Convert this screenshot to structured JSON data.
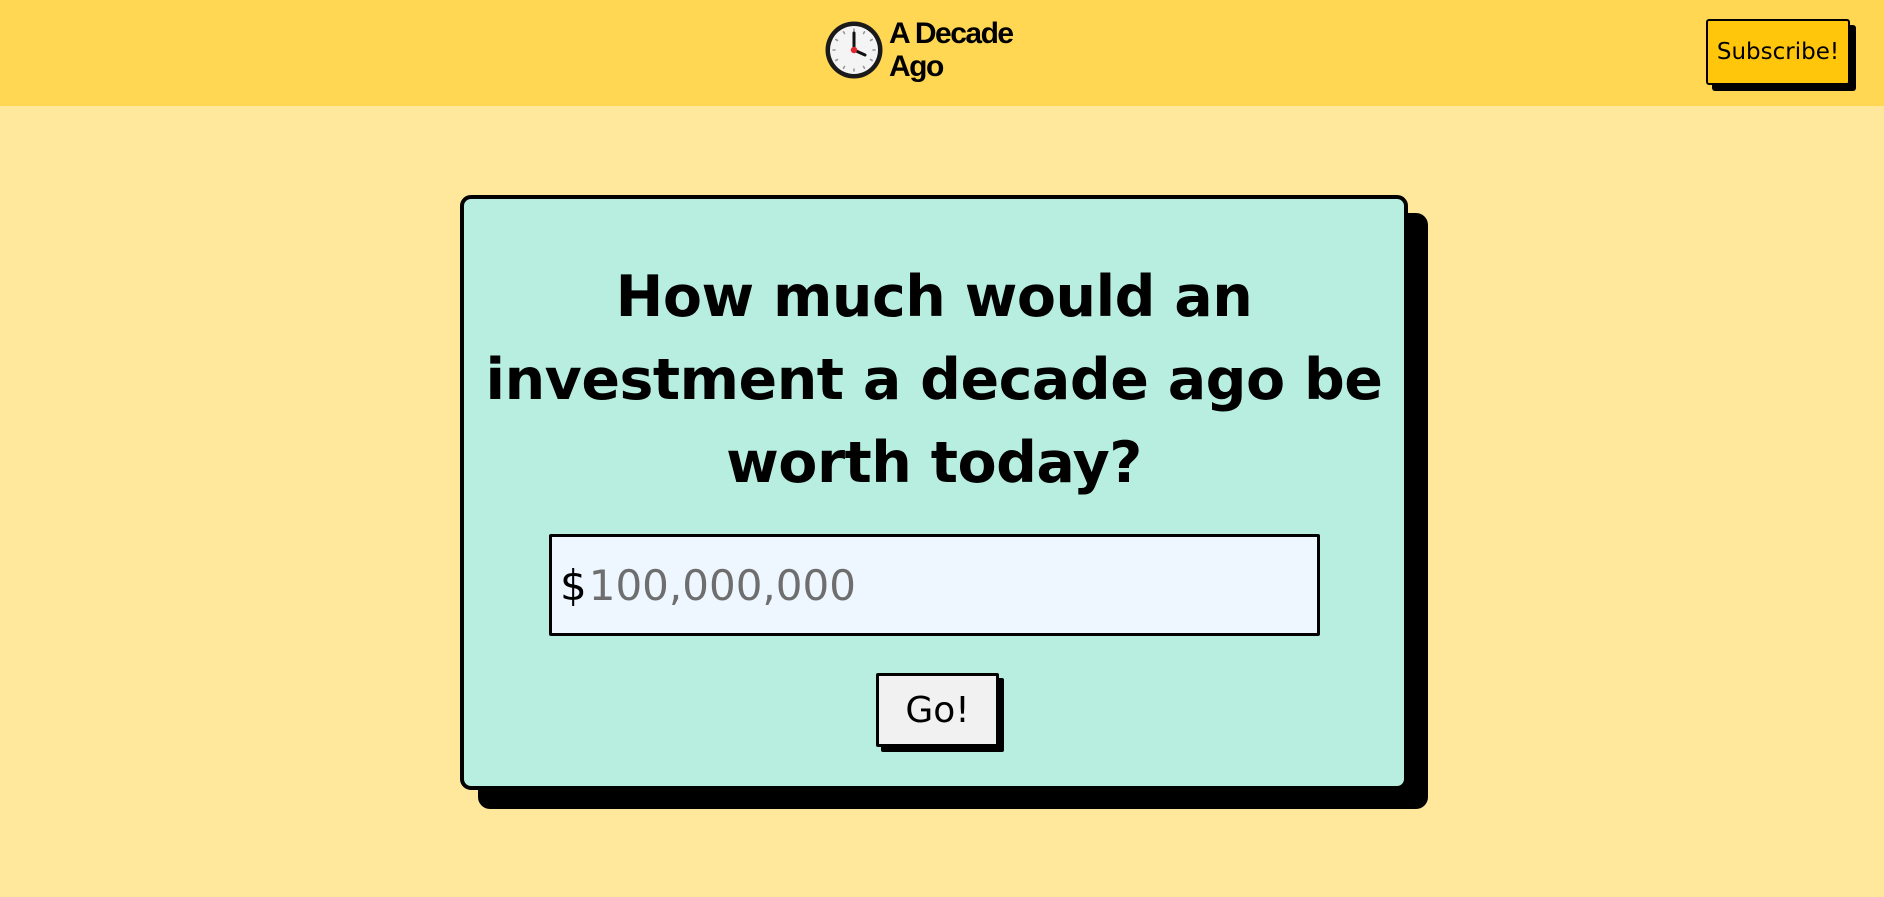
{
  "header": {
    "logo_text": "A Decade Ago",
    "logo_icon": "clock-icon",
    "subscribe_label": "Subscribe!"
  },
  "main": {
    "headline": "How much would an investment a decade ago be worth today?",
    "currency_symbol": "$",
    "amount_placeholder": "100,000,000",
    "go_label": "Go!"
  },
  "colors": {
    "page_background": "#ffe89c",
    "header_background": "#ffd753",
    "subscribe_button": "#ffc60b",
    "card_background": "#b7eee0",
    "input_background": "#eef6ff",
    "button_background": "#f1f1f1",
    "clock_hand_accent": "#e0262a"
  }
}
